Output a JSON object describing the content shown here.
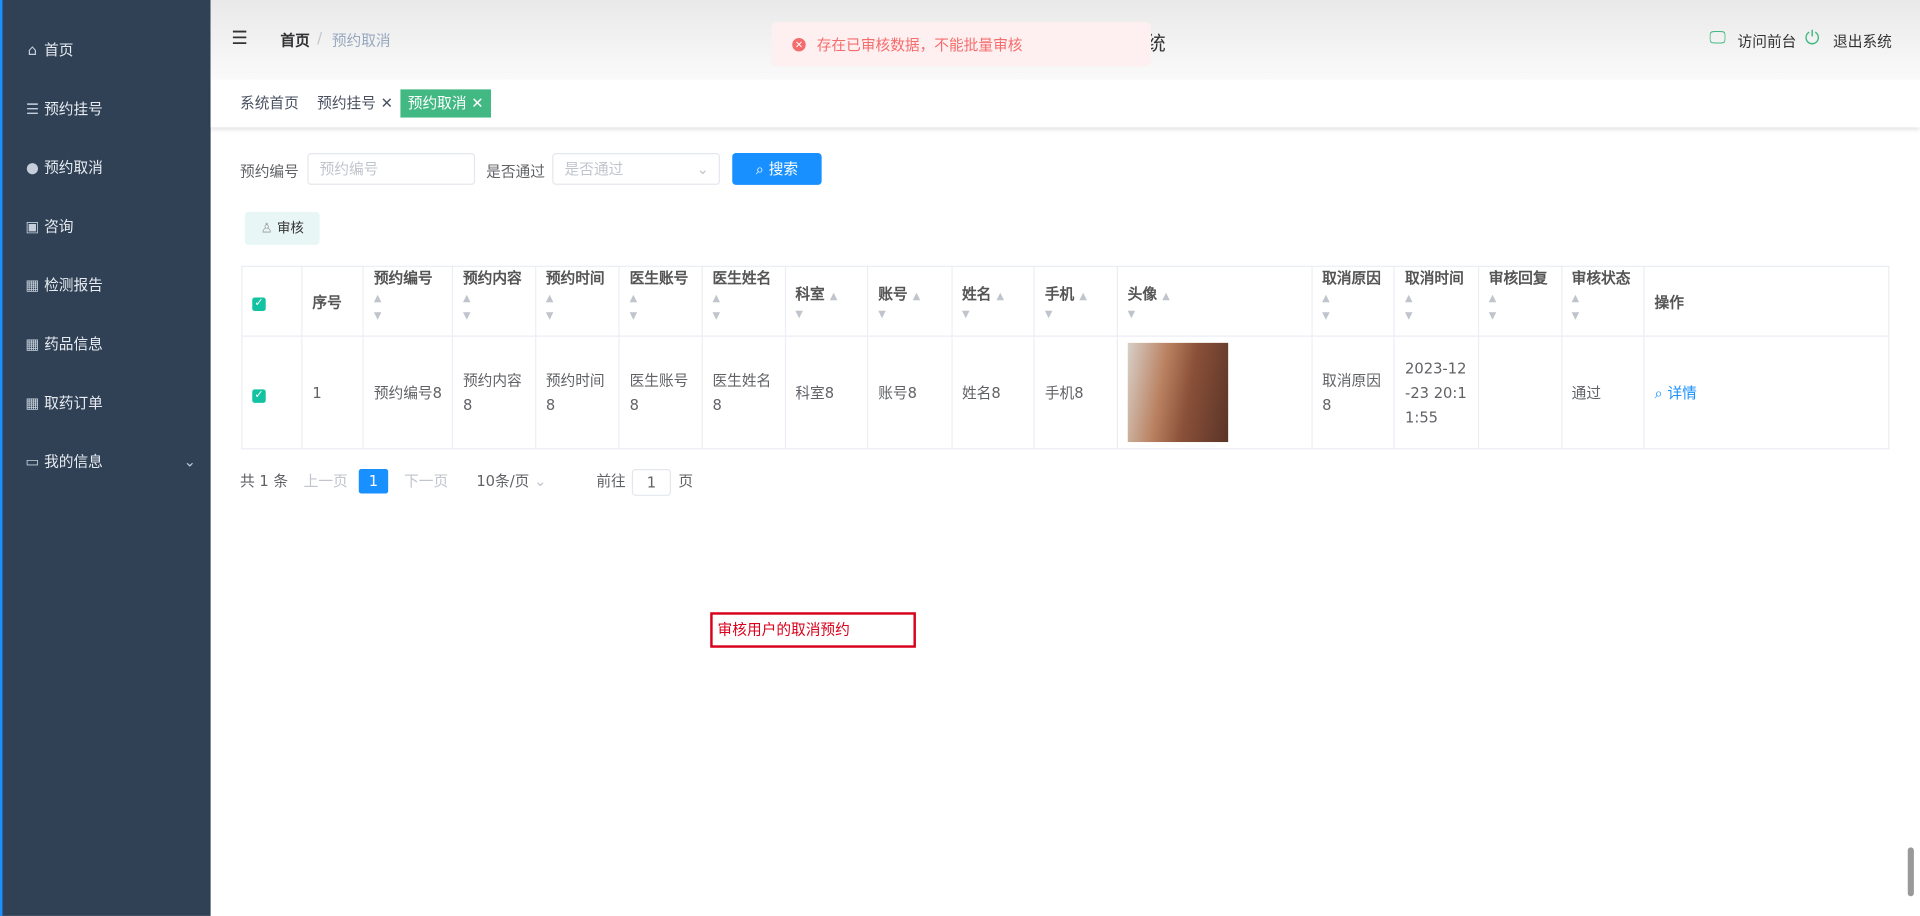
{
  "sidebar": {
    "items": [
      {
        "label": "首页",
        "icon": "⌂"
      },
      {
        "label": "预约挂号",
        "icon": "☰"
      },
      {
        "label": "预约取消",
        "icon": "●"
      },
      {
        "label": "咨询",
        "icon": "▣"
      },
      {
        "label": "检测报告",
        "icon": "▦"
      },
      {
        "label": "药品信息",
        "icon": "▦"
      },
      {
        "label": "取药订单",
        "icon": "▦"
      },
      {
        "label": "我的信息",
        "icon": "▭"
      }
    ]
  },
  "header": {
    "breadcrumb_home": "首页",
    "breadcrumb_sep": "/",
    "breadcrumb_current": "预约取消",
    "title_fragment": "统",
    "visit_front": "访问前台",
    "logout": "退出系统"
  },
  "toast": {
    "message": "存在已审核数据，不能批量审核",
    "color": "#f56c6c"
  },
  "tags": [
    {
      "label": "系统首页"
    },
    {
      "label": "预约挂号 ✕"
    },
    {
      "label": "预约取消 ✕"
    }
  ],
  "search": {
    "label1": "预约编号",
    "placeholder1": "预约编号",
    "label2": "是否通过",
    "placeholder2": "是否通过",
    "button": "搜索"
  },
  "toolbar": {
    "audit": "审核"
  },
  "table": {
    "headers": [
      "序号",
      "预约编号",
      "预约内容",
      "预约时间",
      "医生账号",
      "医生姓名",
      "科室",
      "账号",
      "姓名",
      "手机",
      "头像",
      "取消原因",
      "取消时间",
      "审核回复",
      "审核状态",
      "操作"
    ],
    "rows": [
      {
        "checked": true,
        "cells": [
          "1",
          "预约编号8",
          "预约内容8",
          "预约时间8",
          "医生账号8",
          "医生姓名8",
          "科室8",
          "账号8",
          "姓名8",
          "手机8",
          "",
          "取消原因8",
          "2023-12-23 20:11:55",
          "",
          "通过"
        ],
        "action": "详情"
      }
    ]
  },
  "pagination": {
    "total": "共 1 条",
    "prev": "上一页",
    "current": "1",
    "next": "下一页",
    "page_size": "10条/页",
    "goto": "前往",
    "goto_value": "1",
    "page_unit": "页"
  },
  "annotation": "审核用户的取消预约",
  "colors": {
    "sidebar": "#304156",
    "primary": "#1890ff",
    "tag_active": "#42b983"
  }
}
